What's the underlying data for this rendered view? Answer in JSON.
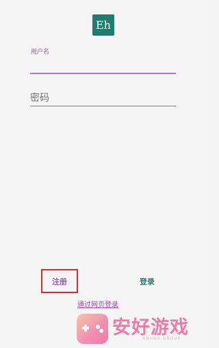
{
  "app": {
    "logo_text": "Eh",
    "accent_color": "#a85ab7",
    "brand_color": "#1e7d6e"
  },
  "form": {
    "username_label": "用户名",
    "username_value": "",
    "password_placeholder": "密码",
    "password_value": ""
  },
  "actions": {
    "register_label": "注册",
    "login_label": "登录",
    "web_login_label": "通过网页登录",
    "highlight_color": "#d32f2f"
  },
  "watermark": {
    "title": "安好游戏",
    "subtitle": "ANHAO GROUP",
    "icon": "gamepad-icon"
  }
}
